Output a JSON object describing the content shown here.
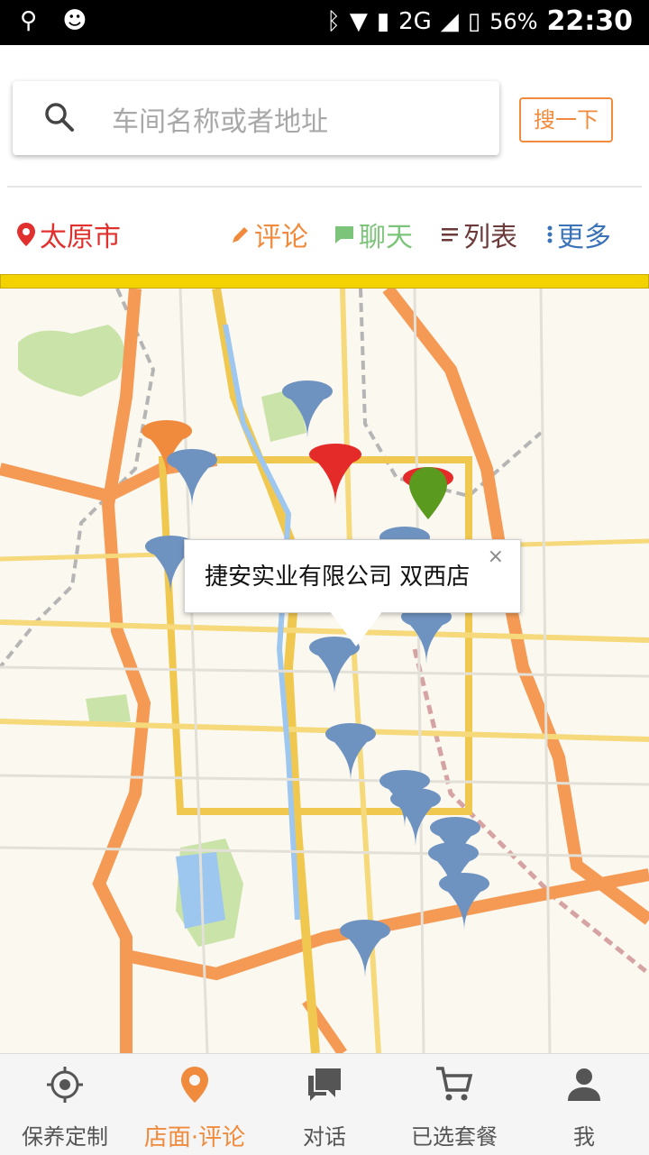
{
  "status_bar": {
    "signal": "2G",
    "battery": "56%",
    "time": "22:30"
  },
  "search": {
    "placeholder": "车间名称或者地址",
    "button_label": "搜一下"
  },
  "filter_bar": {
    "city": "太原市",
    "comment_label": "评论",
    "chat_label": "聊天",
    "list_label": "列表",
    "more_label": "更多"
  },
  "map": {
    "callout_text": "捷安实业有限公司 双西店",
    "close_icon": "×"
  },
  "tabs": [
    {
      "label": "保养定制",
      "icon": "target-icon",
      "active": false
    },
    {
      "label": "店面·评论",
      "icon": "location-pin-icon",
      "active": true
    },
    {
      "label": "对话",
      "icon": "chat-icon",
      "active": false
    },
    {
      "label": "已选套餐",
      "icon": "cart-icon",
      "active": false
    },
    {
      "label": "我",
      "icon": "person-icon",
      "active": false
    }
  ],
  "colors": {
    "accent": "#f08a3c",
    "city_red": "#e0312e",
    "chat_green": "#7cc47a",
    "list_dark": "#6b3a3a",
    "more_blue": "#3a73b8"
  }
}
